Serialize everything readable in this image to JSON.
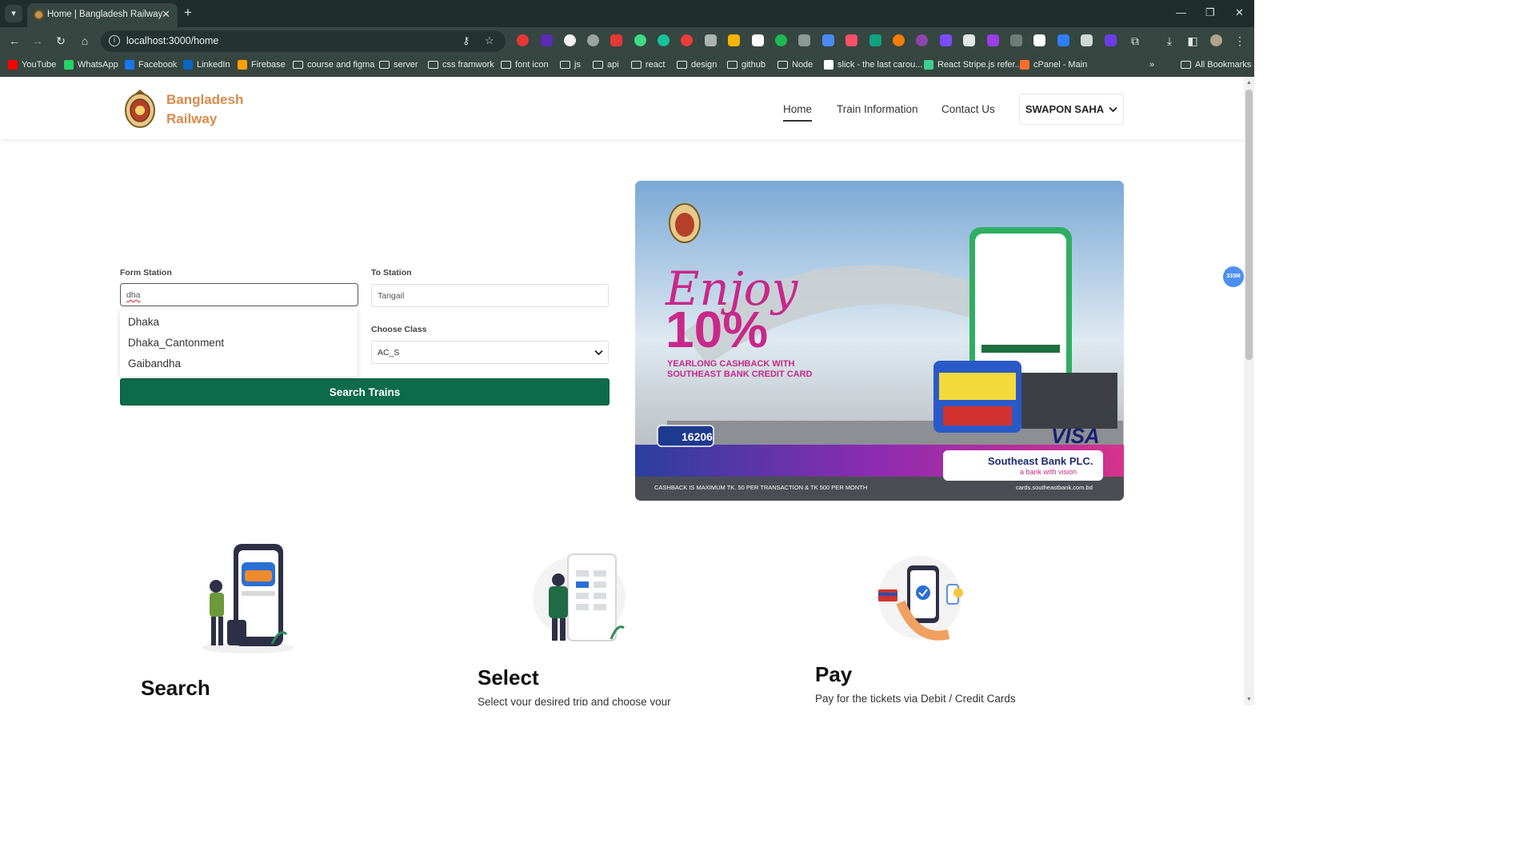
{
  "browser": {
    "tab_title": "Home | Bangladesh Railway",
    "url": "localhost:3000/home",
    "bookmarks": [
      {
        "label": "YouTube",
        "color": "#ff0000"
      },
      {
        "label": "WhatsApp",
        "color": "#25d366"
      },
      {
        "label": "Facebook",
        "color": "#1877f2"
      },
      {
        "label": "LinkedIn",
        "color": "#0a66c2"
      },
      {
        "label": "Firebase",
        "color": "#ffa000"
      },
      {
        "label": "course and figma",
        "folder": true
      },
      {
        "label": "server",
        "folder": true
      },
      {
        "label": "css framwork",
        "folder": true
      },
      {
        "label": "font icon",
        "folder": true
      },
      {
        "label": "js",
        "folder": true
      },
      {
        "label": "api",
        "folder": true
      },
      {
        "label": "react",
        "folder": true
      },
      {
        "label": "design",
        "folder": true
      },
      {
        "label": "github",
        "folder": true
      },
      {
        "label": "Node",
        "folder": true
      },
      {
        "label": "slick - the last carou...",
        "color": "#ffffff"
      },
      {
        "label": "React Stripe.js refer...",
        "color": "#3ecf8e"
      },
      {
        "label": "cPanel - Main",
        "color": "#ff6c2c"
      }
    ],
    "all_bookmarks": "All Bookmarks"
  },
  "header": {
    "brand_line1": "Bangladesh",
    "brand_line2": "Railway",
    "nav": [
      "Home",
      "Train Information",
      "Contact Us"
    ],
    "user": "SWAPON SAHA"
  },
  "form": {
    "from_label": "Form Station",
    "from_value": "dha",
    "to_label": "To Station",
    "to_value": "Tangail",
    "suggestions": [
      "Dhaka",
      "Dhaka_Cantonment",
      "Gaibandha"
    ],
    "class_label": "Choose Class",
    "class_value": "AC_S",
    "search_button": "Search Trains"
  },
  "banner": {
    "headline": "Enjoy",
    "percent": "10%",
    "line1": "YEARLONG CASHBACK WITH",
    "line2": "SOUTHEAST BANK CREDIT CARD",
    "hotline": "16206",
    "card_brand": "VISA",
    "bank_name": "Southeast Bank PLC.",
    "bank_tagline": "a bank with vision",
    "footer": "CASHBACK IS MAXIMUM TK. 50 PER TRANSACTION & TK 500 PER MONTH",
    "website": "cards.southeastbank.com.bd"
  },
  "badge": "333M",
  "steps": [
    {
      "title": "Search",
      "text": ""
    },
    {
      "title": "Select",
      "text": "Select your desired trip and choose your"
    },
    {
      "title": "Pay",
      "text": "Pay for the tickets via Debit / Credit Cards"
    }
  ],
  "colors": {
    "brand": "#d98a4a",
    "primary_button": "#0c6b4a",
    "banner_magenta": "#c8288a"
  }
}
